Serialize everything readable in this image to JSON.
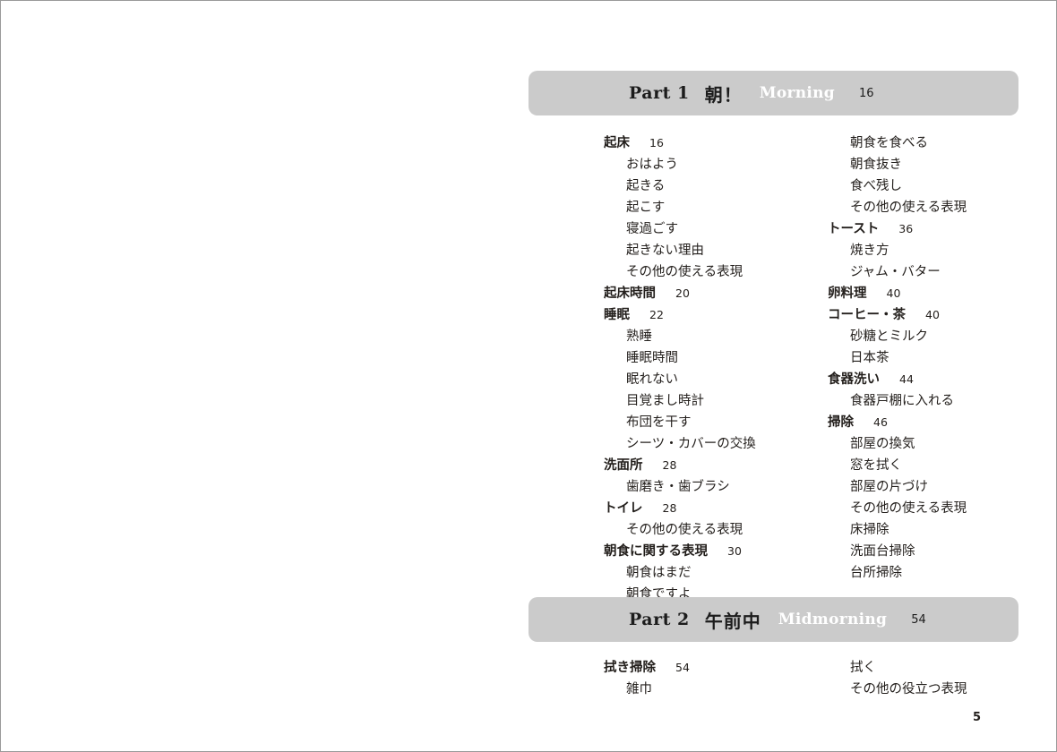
{
  "page": {
    "folio": "5"
  },
  "parts": [
    {
      "bar": {
        "part_label": "Part 1",
        "japanese_title": "朝！",
        "english_title": "Morning",
        "page": "16"
      },
      "columns": {
        "left": [
          {
            "level": "head",
            "title": "起床",
            "page": "16"
          },
          {
            "level": "sub",
            "title": "おはよう",
            "page": ""
          },
          {
            "level": "sub",
            "title": "起きる",
            "page": ""
          },
          {
            "level": "sub",
            "title": "起こす",
            "page": ""
          },
          {
            "level": "sub",
            "title": "寝過ごす",
            "page": ""
          },
          {
            "level": "sub",
            "title": "起きない理由",
            "page": ""
          },
          {
            "level": "sub",
            "title": "その他の使える表現",
            "page": ""
          },
          {
            "level": "head",
            "title": "起床時間",
            "page": "20"
          },
          {
            "level": "head",
            "title": "睡眠",
            "page": "22"
          },
          {
            "level": "sub",
            "title": "熟睡",
            "page": ""
          },
          {
            "level": "sub",
            "title": "睡眠時間",
            "page": ""
          },
          {
            "level": "sub",
            "title": "眠れない",
            "page": ""
          },
          {
            "level": "sub",
            "title": "目覚まし時計",
            "page": ""
          },
          {
            "level": "sub",
            "title": "布団を干す",
            "page": ""
          },
          {
            "level": "sub",
            "title": "シーツ・カバーの交換",
            "page": ""
          },
          {
            "level": "head",
            "title": "洗面所",
            "page": "28"
          },
          {
            "level": "sub",
            "title": "歯磨き・歯ブラシ",
            "page": ""
          },
          {
            "level": "head",
            "title": "トイレ",
            "page": "28"
          },
          {
            "level": "sub",
            "title": "その他の使える表現",
            "page": ""
          },
          {
            "level": "head",
            "title": "朝食に関する表現",
            "page": "30"
          },
          {
            "level": "sub",
            "title": "朝食はまだ",
            "page": ""
          },
          {
            "level": "sub",
            "title": "朝食ですよ",
            "page": ""
          }
        ],
        "right": [
          {
            "level": "sub",
            "title": "朝食を食べる",
            "page": ""
          },
          {
            "level": "sub",
            "title": "朝食抜き",
            "page": ""
          },
          {
            "level": "sub",
            "title": "食べ残し",
            "page": ""
          },
          {
            "level": "sub",
            "title": "その他の使える表現",
            "page": ""
          },
          {
            "level": "head",
            "title": "トースト",
            "page": "36"
          },
          {
            "level": "sub",
            "title": "焼き方",
            "page": ""
          },
          {
            "level": "sub",
            "title": "ジャム・バター",
            "page": ""
          },
          {
            "level": "head",
            "title": "卵料理",
            "page": "40"
          },
          {
            "level": "head",
            "title": "コーヒー・茶",
            "page": "40"
          },
          {
            "level": "sub",
            "title": "砂糖とミルク",
            "page": ""
          },
          {
            "level": "sub",
            "title": "日本茶",
            "page": ""
          },
          {
            "level": "head",
            "title": "食器洗い",
            "page": "44"
          },
          {
            "level": "sub",
            "title": "食器戸棚に入れる",
            "page": ""
          },
          {
            "level": "head",
            "title": "掃除",
            "page": "46"
          },
          {
            "level": "sub",
            "title": "部屋の換気",
            "page": ""
          },
          {
            "level": "sub",
            "title": "窓を拭く",
            "page": ""
          },
          {
            "level": "sub",
            "title": "部屋の片づけ",
            "page": ""
          },
          {
            "level": "sub",
            "title": "その他の使える表現",
            "page": ""
          },
          {
            "level": "sub",
            "title": "床掃除",
            "page": ""
          },
          {
            "level": "sub",
            "title": "洗面台掃除",
            "page": ""
          },
          {
            "level": "sub",
            "title": "台所掃除",
            "page": ""
          }
        ]
      }
    },
    {
      "bar": {
        "part_label": "Part 2",
        "japanese_title": "午前中",
        "english_title": "Midmorning",
        "page": "54"
      },
      "columns": {
        "left": [
          {
            "level": "head",
            "title": "拭き掃除",
            "page": "54"
          },
          {
            "level": "sub",
            "title": "雑巾",
            "page": ""
          }
        ],
        "right": [
          {
            "level": "sub",
            "title": "拭く",
            "page": ""
          },
          {
            "level": "sub",
            "title": "その他の役立つ表現",
            "page": ""
          }
        ]
      }
    }
  ],
  "colors": {
    "bar_gray": "#cbcbcb",
    "text_dark": "#231f1c",
    "bar_english_text": "#ffffff",
    "page_border": "#9a9a9a"
  }
}
